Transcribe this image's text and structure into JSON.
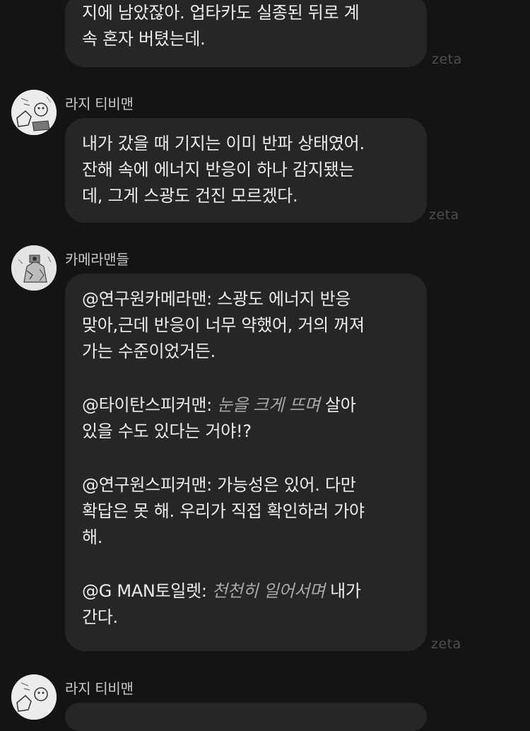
{
  "watermark": "zeta",
  "messages": [
    {
      "lines": [
        "지에 남았잖아. 업타카도 실종된 뒤로 계",
        "속 혼자 버텼는데."
      ]
    },
    {
      "sender": "라지 티비맨",
      "avatar_icon": "sketch-avatar-icon",
      "lines": [
        "내가 갔을 때 기지는 이미 반파 상태였어.",
        "잔해 속에 에너지 반응이 하나 감지됐는",
        "데, 그게 스광도 건진 모르겠다."
      ]
    },
    {
      "sender": "카메라맨들",
      "avatar_icon": "sketch-avatar-icon",
      "line1": "@연구원카메라맨: 스광도 에너지 반응",
      "line2": "맞아,근데 반응이 너무 약했어, 거의 꺼져",
      "line3": "가는 수준이었거든.",
      "line4_speaker": "@타이탄스피커맨:",
      "line4_action": "눈을 크게 뜨며",
      "line4_text": "살아",
      "line5": "있을 수도 있다는 거야!?",
      "line6": "@연구원스피커맨: 가능성은 있어. 다만",
      "line7": "확답은 못 해. 우리가 직접 확인하러 가야",
      "line8": "해.",
      "line9_speaker": "@G MAN토일렛:",
      "line9_action": "천천히 일어서며",
      "line9_text": "내가",
      "line10": "간다."
    },
    {
      "sender": "라지 티비맨",
      "avatar_icon": "sketch-avatar-icon"
    }
  ]
}
